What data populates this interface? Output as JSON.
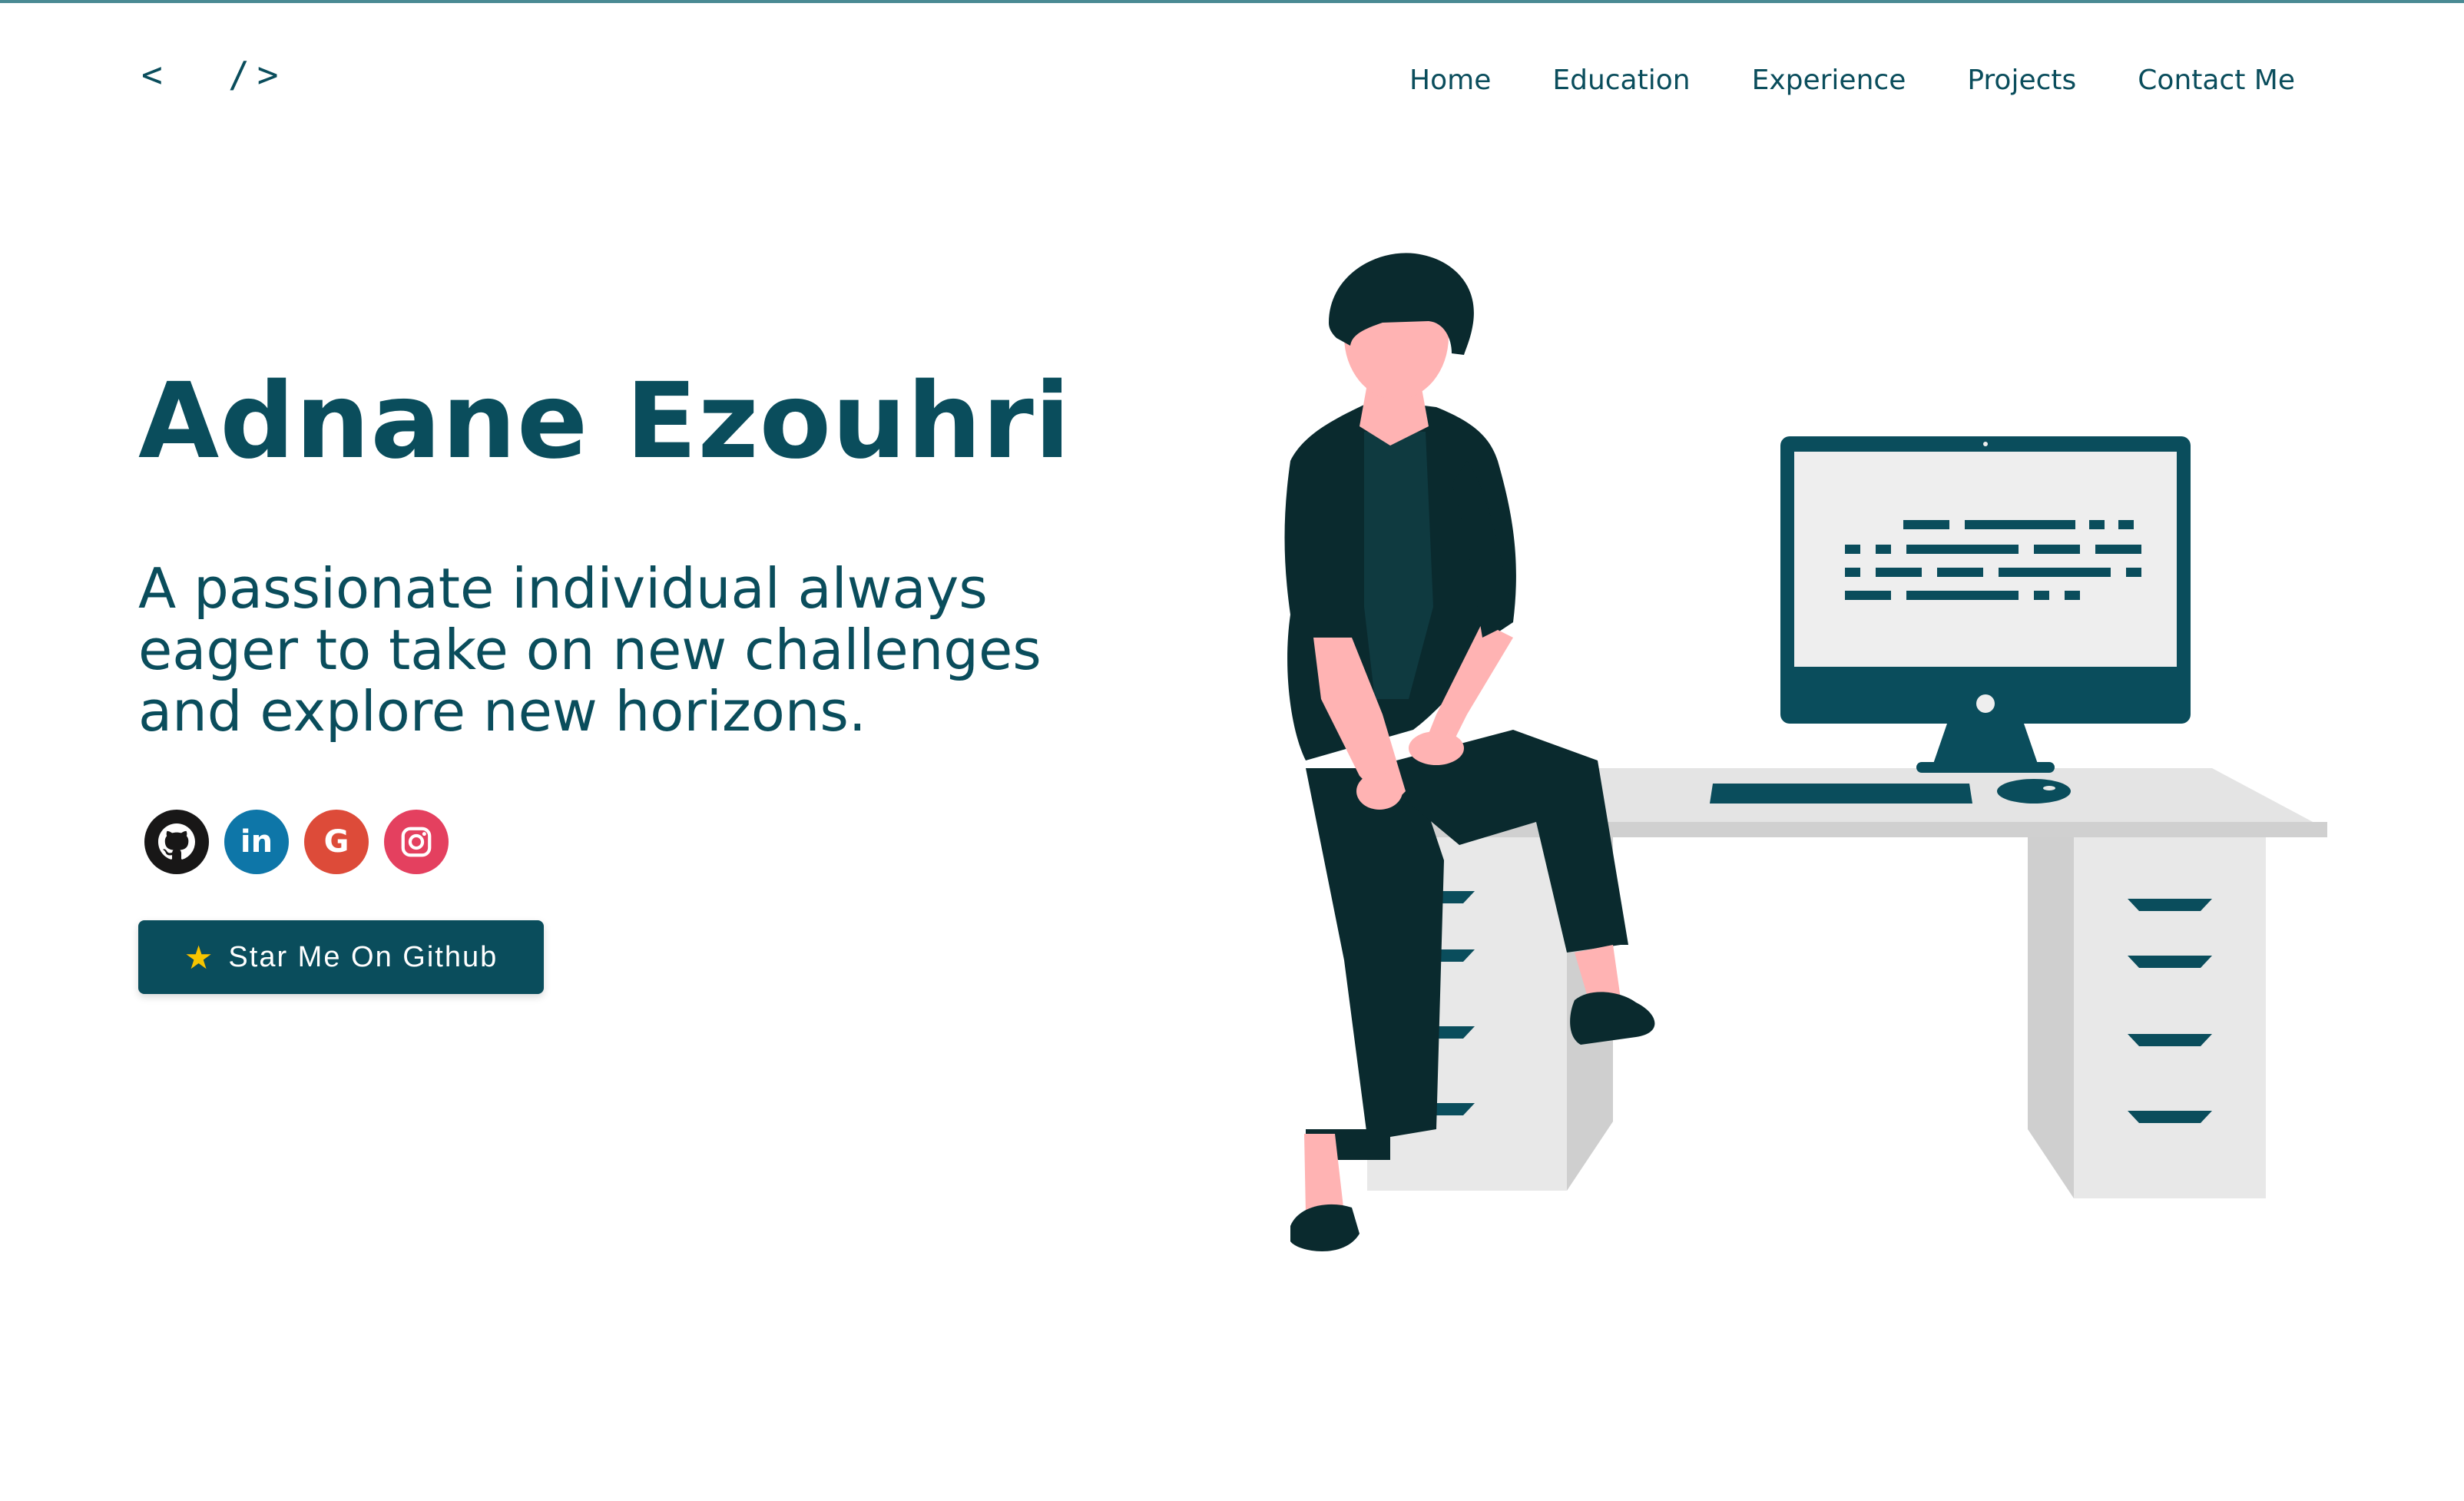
{
  "header": {
    "logo_text": "<  />",
    "nav": [
      "Home",
      "Education",
      "Experience",
      "Projects",
      "Contact Me"
    ]
  },
  "hero": {
    "name": "Adnane Ezouhri",
    "tagline": "A passionate individual always eager to take on new challenges and explore new horizons.",
    "socials": [
      {
        "network": "GitHub",
        "icon": "github-icon",
        "color": "#181717"
      },
      {
        "network": "LinkedIn",
        "icon": "linkedin-icon",
        "glyph": "in",
        "color": "#0e76a8"
      },
      {
        "network": "Google",
        "icon": "google-icon",
        "glyph": "G",
        "color": "#dd4b39"
      },
      {
        "network": "Instagram",
        "icon": "instagram-icon",
        "color": "#e4405f"
      }
    ],
    "cta": {
      "icon": "star-icon",
      "star_glyph": "★",
      "label": "Star Me On Github"
    }
  },
  "theme": {
    "primary": "#0a4d5c",
    "skin": "#ffb3b3",
    "clothing": "#0a2a2e",
    "desk": "#e2e2e2"
  }
}
